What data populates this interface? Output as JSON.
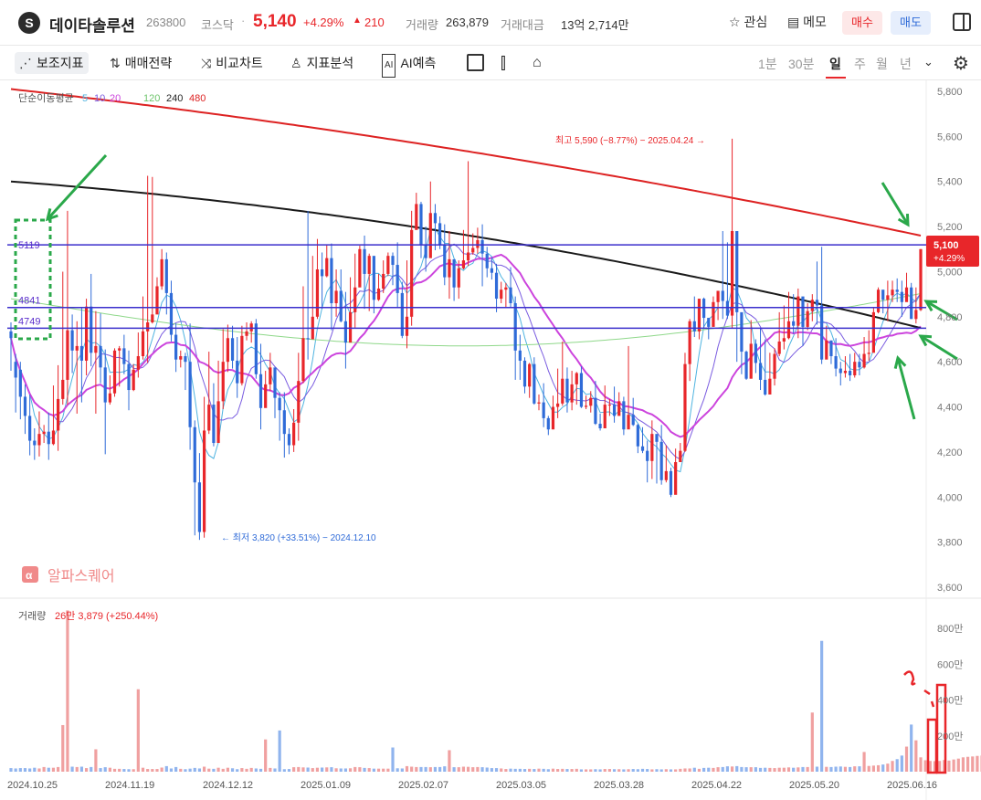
{
  "header": {
    "logo_glyph": "S",
    "name": "데이타솔루션",
    "code": "263800",
    "market": "코스닥",
    "separator": "·",
    "price": "5,140",
    "change_pct": "+4.29%",
    "up_icon": "▲",
    "change": "210",
    "volume_label": "거래량",
    "volume": "263,879",
    "amount_label": "거래대금",
    "amount": "13억 2,714만",
    "favorite_label": "관심",
    "memo_label": "메모",
    "buy_label": "매수",
    "sell_label": "매도"
  },
  "toolbar": {
    "items": [
      {
        "label": "보조지표",
        "icon": "indicator-icon"
      },
      {
        "label": "매매전략",
        "icon": "strategy-icon"
      },
      {
        "label": "비교차트",
        "icon": "compare-icon"
      },
      {
        "label": "지표분석",
        "icon": "analysis-icon"
      },
      {
        "label": "AI예측",
        "icon": "ai-icon"
      }
    ],
    "timeframes": [
      "1분",
      "30분",
      "일",
      "주",
      "월",
      "년"
    ],
    "active_timeframe": "일"
  },
  "colors": {
    "up": "#e8262a",
    "down": "#2f6bd8",
    "ma5": "#4eb3e0",
    "ma10": "#7a5ce0",
    "ma20": "#cc44dd",
    "ma120": "#8fd88a",
    "ma240": "#1a1a1a",
    "ma480": "#dd2222",
    "hline": "#3b2fcc",
    "annotation": "#2aa84a",
    "grid": "#f2f2f2"
  },
  "chart_data": {
    "type": "candlestick",
    "price_axis": {
      "ticks": [
        "5,800",
        "5,600",
        "5,400",
        "5,200",
        "5,000",
        "4,800",
        "4,600",
        "4,400",
        "4,200",
        "4,000",
        "3,800",
        "3,600"
      ],
      "range": [
        3600,
        5800
      ]
    },
    "date_ticks": [
      "2024.10.25",
      "2024.11.19",
      "2024.12.12",
      "2025.01.09",
      "2025.02.07",
      "2025.03.05",
      "2025.03.28",
      "2025.04.22",
      "2025.05.20",
      "2025.06.16"
    ],
    "ma_legend": {
      "title": "단순이동평균",
      "short": [
        "5",
        "10",
        "20"
      ],
      "mid": "120",
      "long": [
        "240",
        "480"
      ]
    },
    "horizontal_lines": [
      {
        "label": "5119",
        "value": 5119
      },
      {
        "label": "4841",
        "value": 4841
      },
      {
        "label": "4749",
        "value": 4749
      }
    ],
    "high_annotation": "최고 5,590 (−8.77%) − 2025.04.24",
    "low_annotation": "최저 3,820 (+33.51%) − 2024.12.10",
    "current_price_tag": {
      "price": "5,100",
      "pct": "+4.29%"
    },
    "watermark": "알파스퀘어",
    "volume": {
      "label": "거래량",
      "value": "26만 3,879 (+250.44%)",
      "ticks": [
        "800만",
        "600만",
        "400만",
        "200만"
      ]
    },
    "candles": [
      [
        4735,
        4705,
        4775,
        4560
      ],
      [
        4600,
        4530,
        4635,
        4375
      ],
      [
        4565,
        4445,
        4600,
        4345
      ],
      [
        4445,
        4360,
        4500,
        4280
      ],
      [
        4360,
        4250,
        4455,
        4185
      ],
      [
        4250,
        4230,
        4305,
        4165
      ],
      [
        4230,
        4280,
        4380,
        4180
      ],
      [
        4280,
        4290,
        4320,
        4240
      ],
      [
        4290,
        4235,
        4375,
        4165
      ],
      [
        4235,
        4295,
        4495,
        4230
      ],
      [
        4295,
        4435,
        4585,
        4205
      ],
      [
        4435,
        4520,
        5000,
        4410
      ],
      [
        4520,
        4740,
        5270,
        4410
      ],
      [
        4740,
        4650,
        4810,
        4550
      ],
      [
        4650,
        4670,
        4780,
        4370
      ],
      [
        4670,
        4605,
        4840,
        4420
      ],
      [
        4605,
        4845,
        4880,
        4540
      ],
      [
        4845,
        4640,
        4990,
        4580
      ],
      [
        4640,
        4670,
        4825,
        4370
      ],
      [
        4670,
        4575,
        4815,
        4505
      ],
      [
        4575,
        4420,
        4655,
        4190
      ],
      [
        4420,
        4460,
        4540,
        4410
      ],
      [
        4460,
        4650,
        4660,
        4445
      ],
      [
        4650,
        4660,
        4670,
        4490
      ],
      [
        4660,
        4590,
        4720,
        4545
      ],
      [
        4590,
        4475,
        4650,
        4385
      ],
      [
        4475,
        4565,
        4590,
        4470
      ],
      [
        4565,
        4625,
        4730,
        4530
      ],
      [
        4625,
        4735,
        4890,
        4610
      ],
      [
        4735,
        4775,
        5425,
        4595
      ],
      [
        4775,
        4810,
        5420,
        4770
      ],
      [
        4810,
        4935,
        4975,
        4875
      ],
      [
        4935,
        5055,
        5100,
        4920
      ],
      [
        5055,
        4905,
        5085,
        4810
      ],
      [
        4905,
        4720,
        4960,
        4690
      ],
      [
        4720,
        4610,
        4770,
        4555
      ],
      [
        4610,
        4625,
        4650,
        4575
      ],
      [
        4625,
        4600,
        4640,
        4475
      ],
      [
        4600,
        4310,
        4770,
        4210
      ],
      [
        4310,
        4065,
        4340,
        3830
      ],
      [
        4065,
        3845,
        4195,
        3810
      ],
      [
        3845,
        4295,
        4445,
        3820
      ],
      [
        4295,
        4410,
        4645,
        4280
      ],
      [
        4410,
        4240,
        4505,
        4225
      ],
      [
        4240,
        4425,
        4605,
        4290
      ],
      [
        4425,
        4600,
        4745,
        4390
      ],
      [
        4600,
        4705,
        4765,
        4555
      ],
      [
        4705,
        4605,
        4760,
        4570
      ],
      [
        4605,
        4505,
        4710,
        4440
      ],
      [
        4505,
        4715,
        4760,
        4495
      ],
      [
        4715,
        4735,
        4775,
        4695
      ],
      [
        4735,
        4770,
        4780,
        4685
      ],
      [
        4770,
        4545,
        4790,
        4525
      ],
      [
        4545,
        4395,
        4680,
        4300
      ],
      [
        4395,
        4500,
        4560,
        4445
      ],
      [
        4500,
        4575,
        4640,
        4470
      ],
      [
        4575,
        4440,
        4560,
        4350
      ],
      [
        4440,
        4385,
        4465,
        4250
      ],
      [
        4385,
        4280,
        4465,
        4175
      ],
      [
        4280,
        4230,
        4305,
        4190
      ],
      [
        4230,
        4330,
        4390,
        4200
      ],
      [
        4330,
        4515,
        4640,
        4250
      ],
      [
        4515,
        4705,
        4935,
        4505
      ],
      [
        4705,
        4700,
        5270,
        4610
      ],
      [
        4700,
        4800,
        5070,
        4705
      ],
      [
        4800,
        5010,
        5145,
        4790
      ],
      [
        5010,
        4980,
        5085,
        4835
      ],
      [
        4980,
        5060,
        5120,
        4975
      ],
      [
        5060,
        4860,
        5125,
        4740
      ],
      [
        4860,
        4915,
        5010,
        4800
      ],
      [
        4915,
        4780,
        5010,
        4775
      ],
      [
        4780,
        4685,
        4910,
        4570
      ],
      [
        4685,
        4820,
        4975,
        4735
      ],
      [
        4820,
        4930,
        5080,
        4750
      ],
      [
        4930,
        5100,
        5115,
        4935
      ],
      [
        5100,
        4990,
        5160,
        4835
      ],
      [
        4990,
        5070,
        5080,
        4825
      ],
      [
        5070,
        4875,
        5065,
        4815
      ],
      [
        4875,
        4925,
        4990,
        4870
      ],
      [
        4925,
        4990,
        5050,
        4905
      ],
      [
        4990,
        5070,
        5085,
        4980
      ],
      [
        5070,
        5030,
        5085,
        4940
      ],
      [
        5030,
        4905,
        5130,
        4840
      ],
      [
        4905,
        4715,
        4955,
        4705
      ],
      [
        4715,
        4800,
        5050,
        4660
      ],
      [
        4800,
        5185,
        5270,
        4760
      ],
      [
        5185,
        5300,
        5350,
        5210
      ],
      [
        5300,
        5120,
        5310,
        5060
      ],
      [
        5120,
        5060,
        5200,
        5000
      ],
      [
        5060,
        5260,
        5400,
        5130
      ],
      [
        5260,
        5215,
        5300,
        5095
      ],
      [
        5215,
        5120,
        5245,
        5100
      ],
      [
        5120,
        4975,
        5210,
        4940
      ],
      [
        4975,
        5055,
        5180,
        4880
      ],
      [
        5055,
        4930,
        5050,
        4870
      ],
      [
        4930,
        5015,
        5050,
        4880
      ],
      [
        5015,
        5050,
        5185,
        5010
      ],
      [
        5050,
        5085,
        5490,
        5025
      ],
      [
        5085,
        5105,
        5170,
        5075
      ],
      [
        5105,
        5140,
        5195,
        5080
      ],
      [
        5140,
        5080,
        5210,
        4935
      ],
      [
        5080,
        5015,
        5110,
        4975
      ],
      [
        5015,
        4995,
        5065,
        4965
      ],
      [
        4995,
        4880,
        5035,
        4820
      ],
      [
        4880,
        4920,
        4955,
        4860
      ],
      [
        4920,
        4930,
        4950,
        4840
      ],
      [
        4930,
        4860,
        5020,
        4840
      ],
      [
        4860,
        4650,
        4890,
        4520
      ],
      [
        4650,
        4605,
        4720,
        4520
      ],
      [
        4605,
        4490,
        4620,
        4460
      ],
      [
        4490,
        4590,
        4595,
        4440
      ],
      [
        4590,
        4415,
        4620,
        4410
      ],
      [
        4415,
        4420,
        4455,
        4385
      ],
      [
        4420,
        4350,
        4505,
        4310
      ],
      [
        4350,
        4300,
        4360,
        4275
      ],
      [
        4300,
        4400,
        4450,
        4310
      ],
      [
        4400,
        4415,
        4570,
        4350
      ],
      [
        4415,
        4525,
        4690,
        4405
      ],
      [
        4525,
        4420,
        4575,
        4375
      ],
      [
        4420,
        4500,
        4560,
        4385
      ],
      [
        4500,
        4550,
        4555,
        4410
      ],
      [
        4550,
        4400,
        4580,
        4395
      ],
      [
        4400,
        4405,
        4450,
        4390
      ],
      [
        4405,
        4440,
        4470,
        4375
      ],
      [
        4440,
        4325,
        4515,
        4320
      ],
      [
        4325,
        4305,
        4370,
        4295
      ],
      [
        4305,
        4410,
        4495,
        4345
      ],
      [
        4410,
        4410,
        4435,
        4360
      ],
      [
        4410,
        4360,
        4490,
        4330
      ],
      [
        4360,
        4425,
        4465,
        4370
      ],
      [
        4425,
        4300,
        4445,
        4275
      ],
      [
        4300,
        4365,
        4670,
        4310
      ],
      [
        4365,
        4320,
        4440,
        4315
      ],
      [
        4320,
        4225,
        4325,
        4195
      ],
      [
        4225,
        4205,
        4310,
        4195
      ],
      [
        4205,
        4160,
        4250,
        4065
      ],
      [
        4160,
        4280,
        4340,
        4080
      ],
      [
        4280,
        4245,
        4265,
        4060
      ],
      [
        4245,
        4075,
        4320,
        4055
      ],
      [
        4075,
        4115,
        4230,
        4065
      ],
      [
        4115,
        4010,
        4130,
        4000
      ],
      [
        4010,
        4155,
        4215,
        4050
      ],
      [
        4155,
        4205,
        4240,
        4195
      ],
      [
        4205,
        4590,
        4640,
        4200
      ],
      [
        4590,
        4780,
        4790,
        4515
      ],
      [
        4780,
        4735,
        4890,
        4710
      ],
      [
        4735,
        4880,
        4865,
        4700
      ],
      [
        4880,
        4795,
        4885,
        4750
      ],
      [
        4795,
        4755,
        4780,
        4700
      ],
      [
        4755,
        4865,
        4890,
        4785
      ],
      [
        4865,
        4915,
        4885,
        4785
      ],
      [
        4915,
        4870,
        5180,
        4790
      ],
      [
        4870,
        4805,
        5130,
        4790
      ],
      [
        4805,
        5180,
        5590,
        4750
      ],
      [
        5180,
        4820,
        4860,
        4600
      ],
      [
        4820,
        4645,
        4755,
        4545
      ],
      [
        4645,
        4525,
        4650,
        4520
      ],
      [
        4525,
        4680,
        4785,
        4580
      ],
      [
        4680,
        4595,
        4700,
        4550
      ],
      [
        4595,
        4520,
        4750,
        4475
      ],
      [
        4520,
        4455,
        4700,
        4450
      ],
      [
        4455,
        4525,
        4640,
        4480
      ],
      [
        4525,
        4635,
        4660,
        4495
      ],
      [
        4635,
        4690,
        4820,
        4625
      ],
      [
        4690,
        4705,
        4850,
        4655
      ],
      [
        4705,
        4780,
        4910,
        4700
      ],
      [
        4780,
        4760,
        4900,
        4725
      ],
      [
        4760,
        4890,
        4925,
        4705
      ],
      [
        4890,
        4755,
        4810,
        4670
      ],
      [
        4755,
        4825,
        4860,
        4740
      ],
      [
        4825,
        4875,
        4900,
        4780
      ],
      [
        4875,
        4850,
        5045,
        4765
      ],
      [
        4850,
        4610,
        5110,
        4590
      ],
      [
        4610,
        4695,
        4760,
        4635
      ],
      [
        4695,
        4625,
        4690,
        4590
      ],
      [
        4625,
        4570,
        4705,
        4535
      ],
      [
        4570,
        4550,
        4600,
        4495
      ],
      [
        4550,
        4560,
        4625,
        4530
      ],
      [
        4560,
        4540,
        4635,
        4515
      ],
      [
        4540,
        4600,
        4640,
        4530
      ],
      [
        4600,
        4575,
        4635,
        4540
      ],
      [
        4575,
        4635,
        4710,
        4570
      ],
      [
        4635,
        4640,
        4740,
        4605
      ],
      [
        4640,
        4820,
        4840,
        4700
      ],
      [
        4820,
        4920,
        4930,
        4815
      ],
      [
        4920,
        4875,
        4910,
        4815
      ],
      [
        4875,
        4895,
        4960,
        4780
      ],
      [
        4895,
        4920,
        4960,
        4865
      ],
      [
        4920,
        4910,
        4970,
        4865
      ],
      [
        4910,
        4865,
        4960,
        4800
      ],
      [
        4865,
        4930,
        4995,
        4870
      ],
      [
        4930,
        4790,
        4950,
        4790
      ],
      [
        4790,
        4830,
        4930,
        4770
      ],
      [
        4830,
        5100,
        5100,
        4825
      ]
    ],
    "volumes": [
      20,
      18,
      20,
      20,
      18,
      22,
      18,
      26,
      22,
      22,
      26,
      25,
      27,
      28,
      26,
      28,
      20,
      26,
      24,
      20,
      25,
      22,
      16,
      16,
      15,
      14,
      14,
      14,
      22,
      15,
      15,
      15,
      23,
      31,
      18,
      26,
      16,
      14,
      17,
      21,
      18,
      28,
      17,
      16,
      22,
      16,
      22,
      19,
      14,
      20,
      16,
      21,
      18,
      16,
      16,
      21,
      18,
      14,
      14,
      15,
      25,
      26,
      24,
      23,
      20,
      22,
      23,
      24,
      25,
      19,
      18,
      18,
      19,
      26,
      25,
      21,
      20,
      17,
      17,
      17,
      17,
      18,
      19,
      18,
      31,
      28,
      26,
      26,
      26,
      25,
      26,
      26,
      30,
      35,
      25,
      25,
      28,
      27,
      25,
      26,
      25,
      23,
      20,
      20,
      18,
      15,
      17,
      16,
      16,
      15,
      16,
      15,
      17,
      16,
      14,
      17,
      15,
      16,
      15,
      15,
      16,
      13,
      13,
      13,
      14,
      13,
      15,
      15,
      14,
      14,
      13,
      14,
      15,
      14,
      16,
      15,
      13,
      14,
      13,
      14,
      13,
      13,
      16,
      18,
      18,
      22,
      16,
      21,
      22,
      21,
      25,
      26,
      30,
      29,
      31,
      26,
      25,
      25,
      25,
      21,
      22,
      21,
      20,
      22,
      22,
      24,
      22,
      24,
      26,
      26,
      24,
      28,
      30,
      27,
      26,
      28,
      29,
      27,
      26,
      30,
      30,
      31,
      32,
      34,
      36,
      40,
      45,
      60,
      70,
      90,
      140,
      263,
      175,
      80,
      64,
      60,
      59,
      60,
      65,
      62,
      68,
      73,
      80,
      83,
      85,
      88,
      90,
      92,
      96,
      100,
      120,
      263
    ],
    "volume_spikes": [
      {
        "index": 11,
        "value": 260
      },
      {
        "index": 12,
        "value": 900
      },
      {
        "index": 18,
        "value": 125
      },
      {
        "index": 27,
        "value": 460
      },
      {
        "index": 54,
        "value": 180
      },
      {
        "index": 57,
        "value": 230
      },
      {
        "index": 81,
        "value": 135
      },
      {
        "index": 93,
        "value": 120
      },
      {
        "index": 170,
        "value": 330
      },
      {
        "index": 172,
        "value": 730
      },
      {
        "index": 181,
        "value": 110
      }
    ]
  }
}
